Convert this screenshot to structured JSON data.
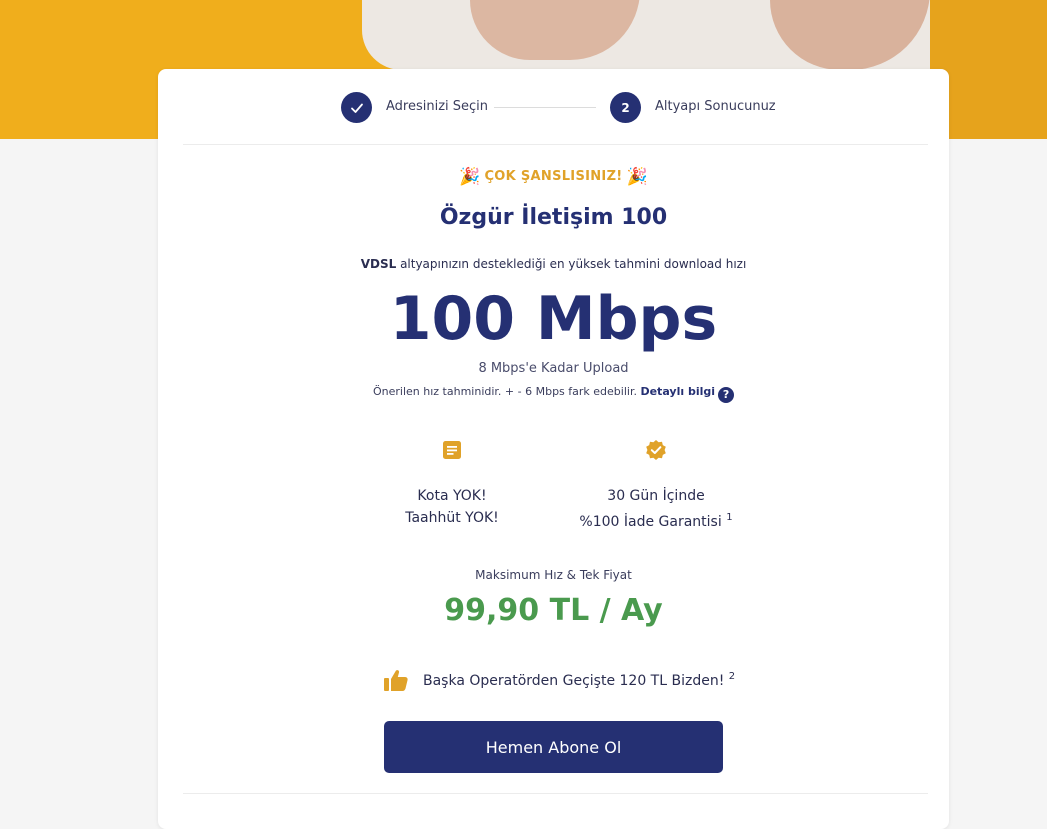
{
  "stepper": {
    "step1_label": "Adresinizi Seçin",
    "step1_icon": "check-icon",
    "step2_number": "2",
    "step2_label": "Altyapı Sonucunuz"
  },
  "result": {
    "lucky_text": "ÇOK ŞANSLISINIZ!",
    "lucky_icon": "party-popper-icon",
    "plan_name": "Özgür İletişim 100",
    "infra_type": "VDSL",
    "infra_desc": " altyapınızın desteklediği en yüksek tahmini download hızı",
    "download_speed": "100 Mbps",
    "upload_text": "8 Mbps'e Kadar Upload",
    "note_text": "Önerilen hız tahminidir. + - 6 Mbps fark edebilir. ",
    "detail_link": "Detaylı bilgi",
    "help_glyph": "?"
  },
  "features": [
    {
      "icon": "document-icon",
      "line1": "Kota YOK!",
      "line2": "Taahhüt YOK!",
      "sup": ""
    },
    {
      "icon": "verified-badge-icon",
      "line1": "30 Gün İçinde",
      "line2": "%100 İade Garantisi",
      "sup": "1"
    }
  ],
  "pricing": {
    "label": "Maksimum Hız & Tek Fiyat",
    "price": "99,90 TL / Ay"
  },
  "switch_offer": {
    "icon": "thumbs-up-icon",
    "text": "Başka Operatörden Geçişte 120 TL Bizden!",
    "sup": "2"
  },
  "cta": {
    "label": "Hemen Abone Ol"
  },
  "colors": {
    "brand_navy": "#253073",
    "accent_yellow": "#f0ae1c",
    "price_green": "#4a9a4e",
    "lucky_gold": "#e0a229"
  }
}
